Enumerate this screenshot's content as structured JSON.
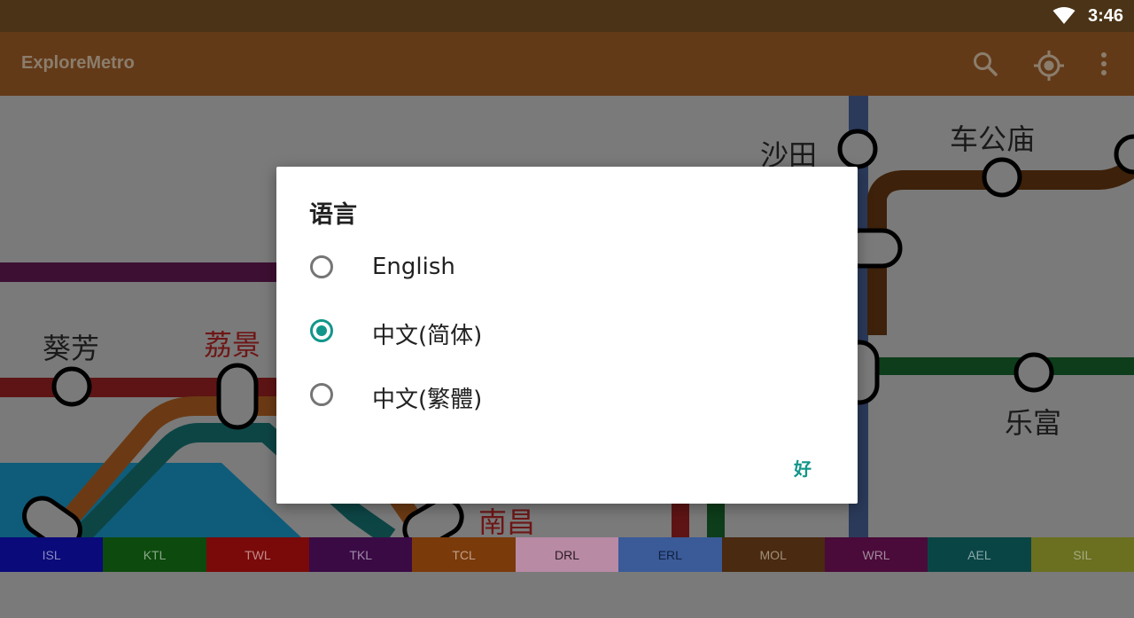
{
  "status_bar": {
    "time": "3:46"
  },
  "app_bar": {
    "title": "ExploreMetro",
    "icons": [
      "search-icon",
      "locate-icon",
      "more-vert-icon"
    ]
  },
  "map": {
    "stations": {
      "sha_tin": "沙田",
      "che_kung_temple": "车公庙",
      "kwai_fong": "葵芳",
      "lai_king": "荔景",
      "tai_wai_partial": "乐富",
      "nam_cheong": "南昌"
    }
  },
  "dialog": {
    "title": "语言",
    "options": [
      {
        "label": "English",
        "checked": false
      },
      {
        "label": "中文(简体)",
        "checked": true
      },
      {
        "label": "中文(繁體)",
        "checked": false
      }
    ],
    "ok_label": "好"
  },
  "line_bar": [
    {
      "code": "ISL",
      "bg": "#0a0a7a",
      "fg": "#8a8ac0"
    },
    {
      "code": "KTL",
      "bg": "#0d4a0d",
      "fg": "#8aa88a"
    },
    {
      "code": "TWL",
      "bg": "#7a0a0a",
      "fg": "#c08a8a"
    },
    {
      "code": "TKL",
      "bg": "#3a0a45",
      "fg": "#a08aa8"
    },
    {
      "code": "TCL",
      "bg": "#7a3a0a",
      "fg": "#c0a08a"
    },
    {
      "code": "DRL",
      "bg": "#b88aa4",
      "fg": "#2a1a22"
    },
    {
      "code": "ERL",
      "bg": "#3a5a98",
      "fg": "#102040"
    },
    {
      "code": "MOL",
      "bg": "#4a2a10",
      "fg": "#a0907a"
    },
    {
      "code": "WRL",
      "bg": "#4a0a3a",
      "fg": "#a08a9a"
    },
    {
      "code": "AEL",
      "bg": "#0a4545",
      "fg": "#8aa8a8"
    },
    {
      "code": "SIL",
      "bg": "#6a7020",
      "fg": "#a8aa80"
    }
  ],
  "colors": {
    "accent": "#12968a",
    "status_bar": "#4a3316",
    "app_bar": "#633a18"
  }
}
